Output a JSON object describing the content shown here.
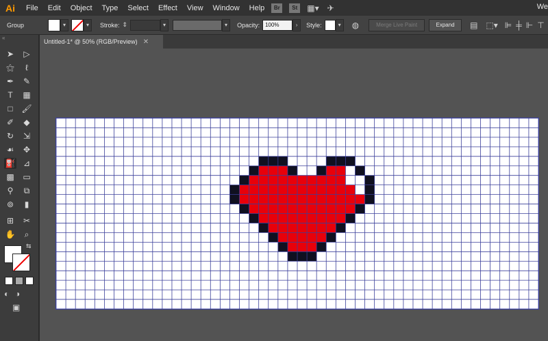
{
  "app": {
    "logo": "Ai",
    "menus": [
      "File",
      "Edit",
      "Object",
      "Type",
      "Select",
      "Effect",
      "View",
      "Window",
      "Help"
    ],
    "bridge": "Br",
    "stock": "St",
    "workspace_label": "We"
  },
  "control": {
    "selection_type": "Group",
    "stroke_label": "Stroke:",
    "opacity_label": "Opacity:",
    "opacity_value": "100%",
    "style_label": "Style:",
    "merge_button": "Merge Live Paint",
    "expand_button": "Expand"
  },
  "document": {
    "tab_title": "Untitled-1* @ 50% (RGB/Preview)"
  },
  "toolbar": {
    "tools": [
      "selection-icon",
      "direct-selection-icon",
      "magic-wand-icon",
      "lasso-icon",
      "pen-icon",
      "curvature-icon",
      "type-icon",
      "grid-tool-icon",
      "rectangle-icon",
      "paintbrush-icon",
      "shaper-icon",
      "eraser-icon",
      "rotate-icon",
      "scale-icon",
      "warp-icon",
      "free-transform-icon",
      "live-paint-bucket-icon",
      "perspective-grid-icon",
      "mesh-icon",
      "gradient-icon",
      "eyedropper-icon",
      "blend-icon",
      "symbol-sprayer-icon",
      "column-graph-icon",
      "artboard-icon",
      "slice-icon",
      "hand-icon",
      "zoom-icon"
    ]
  },
  "pixel_art": {
    "description_colors": {
      "outline": "#101020",
      "fill": "#e8000a",
      "highlight": "#ffffff",
      "grid": "#3a3f9a"
    },
    "grid_cols": 50,
    "grid_rows": 20
  }
}
